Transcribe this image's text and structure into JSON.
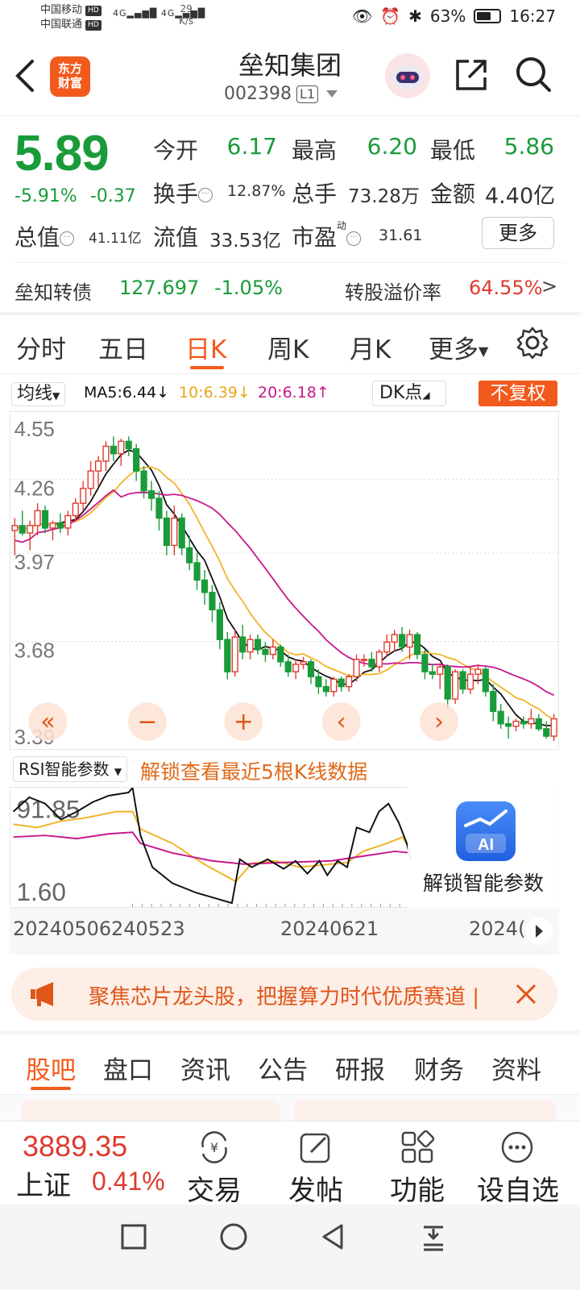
{
  "status_bar": {
    "carrier1": "中国移动",
    "carrier2": "中国联通",
    "hd": "HD",
    "signal": "4G",
    "speed_value": "29",
    "speed_unit": "K/s",
    "battery": "63%",
    "battery_level": 0.63,
    "time": "16:27"
  },
  "header": {
    "logo_line1": "东方",
    "logo_line2": "财富",
    "title": "垒知集团",
    "code": "002398",
    "level": "L1"
  },
  "quote": {
    "price": "5.89",
    "change_pct": "-5.91%",
    "change_abs": "-0.37",
    "open_label": "今开",
    "open": "6.17",
    "high_label": "最高",
    "high": "6.20",
    "low_label": "最低",
    "low": "5.86",
    "turnover_label": "换手",
    "turnover": "12.87%",
    "volume_label": "总手",
    "volume": "73.28万",
    "amount_label": "金额",
    "amount": "4.40亿",
    "mktcap_label": "总值",
    "mktcap": "41.11亿",
    "float_label": "流值",
    "float_cap": "33.53亿",
    "pe_label": "市盈",
    "pe_sup": "动",
    "pe": "31.61",
    "more": "更多"
  },
  "bond": {
    "name": "垒知转债",
    "price": "127.697",
    "change": "-1.05%",
    "premium_label": "转股溢价率",
    "premium": "64.55%",
    "arrow": ">"
  },
  "period_tabs": [
    "分时",
    "五日",
    "日K",
    "周K",
    "月K",
    "更多"
  ],
  "period_active": 2,
  "chart_toolbar": {
    "ma_select": "均线",
    "ma5": "MA5:6.44",
    "ma10": "10:6.39",
    "ma20": "20:6.18",
    "dk": "DK点",
    "fq": "不复权"
  },
  "colors": {
    "up": "#e03a2f",
    "down": "#1a9b3a",
    "accent": "#f25a1d",
    "ma5": "#111111",
    "ma10": "#f0b429",
    "ma20": "#c8188c"
  },
  "chart_data": [
    {
      "type": "candlestick",
      "y_ticks": [
        "4.55",
        "4.26",
        "3.97",
        "3.68",
        "3.39"
      ],
      "ylim": [
        3.39,
        4.64
      ],
      "ohlc": [
        [
          4.22,
          4.27,
          4.12,
          4.24
        ],
        [
          4.24,
          4.3,
          4.2,
          4.21
        ],
        [
          4.21,
          4.26,
          4.14,
          4.24
        ],
        [
          4.24,
          4.33,
          4.2,
          4.3
        ],
        [
          4.3,
          4.32,
          4.21,
          4.23
        ],
        [
          4.23,
          4.26,
          4.18,
          4.25
        ],
        [
          4.25,
          4.29,
          4.21,
          4.23
        ],
        [
          4.23,
          4.3,
          4.2,
          4.28
        ],
        [
          4.28,
          4.35,
          4.26,
          4.33
        ],
        [
          4.33,
          4.42,
          4.3,
          4.39
        ],
        [
          4.39,
          4.5,
          4.36,
          4.46
        ],
        [
          4.46,
          4.52,
          4.4,
          4.5
        ],
        [
          4.5,
          4.58,
          4.46,
          4.56
        ],
        [
          4.56,
          4.6,
          4.5,
          4.53
        ],
        [
          4.53,
          4.59,
          4.48,
          4.58
        ],
        [
          4.58,
          4.6,
          4.52,
          4.55
        ],
        [
          4.55,
          4.57,
          4.42,
          4.46
        ],
        [
          4.46,
          4.48,
          4.35,
          4.38
        ],
        [
          4.38,
          4.42,
          4.3,
          4.35
        ],
        [
          4.35,
          4.38,
          4.22,
          4.27
        ],
        [
          4.27,
          4.3,
          4.12,
          4.16
        ],
        [
          4.16,
          4.32,
          4.12,
          4.27
        ],
        [
          4.27,
          4.29,
          4.12,
          4.15
        ],
        [
          4.15,
          4.2,
          4.06,
          4.09
        ],
        [
          4.09,
          4.13,
          3.98,
          4.02
        ],
        [
          4.02,
          4.06,
          3.92,
          3.97
        ],
        [
          3.97,
          4.0,
          3.85,
          3.9
        ],
        [
          3.9,
          3.93,
          3.74,
          3.78
        ],
        [
          3.78,
          3.81,
          3.62,
          3.65
        ],
        [
          3.65,
          3.82,
          3.63,
          3.79
        ],
        [
          3.79,
          3.84,
          3.7,
          3.73
        ],
        [
          3.73,
          3.8,
          3.7,
          3.78
        ],
        [
          3.78,
          3.8,
          3.72,
          3.74
        ],
        [
          3.74,
          3.77,
          3.69,
          3.72
        ],
        [
          3.72,
          3.78,
          3.7,
          3.75
        ],
        [
          3.75,
          3.76,
          3.67,
          3.69
        ],
        [
          3.69,
          3.72,
          3.63,
          3.65
        ],
        [
          3.65,
          3.7,
          3.62,
          3.68
        ],
        [
          3.68,
          3.71,
          3.66,
          3.69
        ],
        [
          3.69,
          3.7,
          3.6,
          3.63
        ],
        [
          3.63,
          3.66,
          3.56,
          3.59
        ],
        [
          3.59,
          3.62,
          3.55,
          3.57
        ],
        [
          3.57,
          3.63,
          3.55,
          3.62
        ],
        [
          3.62,
          3.63,
          3.57,
          3.59
        ],
        [
          3.59,
          3.64,
          3.57,
          3.63
        ],
        [
          3.63,
          3.72,
          3.61,
          3.7
        ],
        [
          3.7,
          3.72,
          3.67,
          3.7
        ],
        [
          3.7,
          3.73,
          3.65,
          3.67
        ],
        [
          3.67,
          3.74,
          3.65,
          3.73
        ],
        [
          3.73,
          3.8,
          3.71,
          3.77
        ],
        [
          3.77,
          3.82,
          3.73,
          3.8
        ],
        [
          3.8,
          3.83,
          3.73,
          3.75
        ],
        [
          3.75,
          3.82,
          3.7,
          3.8
        ],
        [
          3.8,
          3.81,
          3.7,
          3.72
        ],
        [
          3.72,
          3.74,
          3.62,
          3.65
        ],
        [
          3.65,
          3.68,
          3.62,
          3.64
        ],
        [
          3.64,
          3.68,
          3.58,
          3.67
        ],
        [
          3.67,
          3.68,
          3.5,
          3.54
        ],
        [
          3.54,
          3.66,
          3.52,
          3.65
        ],
        [
          3.65,
          3.66,
          3.56,
          3.58
        ],
        [
          3.58,
          3.67,
          3.56,
          3.64
        ],
        [
          3.64,
          3.68,
          3.6,
          3.66
        ],
        [
          3.66,
          3.67,
          3.55,
          3.57
        ],
        [
          3.57,
          3.6,
          3.45,
          3.49
        ],
        [
          3.49,
          3.52,
          3.42,
          3.44
        ],
        [
          3.44,
          3.47,
          3.38,
          3.43
        ],
        [
          3.43,
          3.46,
          3.41,
          3.45
        ],
        [
          3.45,
          3.47,
          3.42,
          3.44
        ],
        [
          3.44,
          3.5,
          3.42,
          3.46
        ],
        [
          3.46,
          3.48,
          3.41,
          3.42
        ],
        [
          3.42,
          3.45,
          3.38,
          3.39
        ],
        [
          3.39,
          3.48,
          3.37,
          3.46
        ]
      ]
    },
    {
      "type": "line",
      "name": "RSI",
      "y_ticks": [
        "91.85",
        "1.60"
      ],
      "ylim": [
        0,
        100
      ]
    }
  ],
  "chart_controls": [
    "«",
    "−",
    "+",
    "‹",
    "›"
  ],
  "rsi_toolbar": {
    "select": "RSI智能参数",
    "unlock": "解锁查看最近5根K线数据"
  },
  "rsi_panel": {
    "ai": "AI",
    "unlock_text": "解锁智能参数"
  },
  "dates": [
    "20240506",
    "240523",
    "20240621",
    "2024("
  ],
  "banner": {
    "text": "聚焦芯片龙头股，把握算力时代优质赛道 | "
  },
  "section_tabs": [
    "股吧",
    "盘口",
    "资讯",
    "公告",
    "研报",
    "财务",
    "资料"
  ],
  "section_active": 0,
  "bottom": {
    "index_value": "3889.35",
    "index_name": "上证",
    "index_pct": "0.41%",
    "trade": "交易",
    "post": "发帖",
    "functions": "功能",
    "watchlist": "设自选"
  }
}
